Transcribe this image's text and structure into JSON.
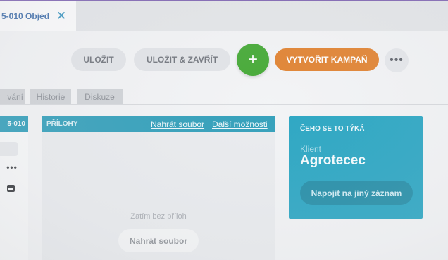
{
  "header": {
    "tab_title": "5-010 Objed",
    "close_glyph": "✕"
  },
  "toolbar": {
    "save_label": "ULOŽIT",
    "save_close_label": "ULOŽIT & ZAVŘÍT",
    "add_glyph": "+",
    "create_campaign_label": "VYTVOŘIT KAMPAŇ",
    "more_glyph": "•••"
  },
  "tabs": [
    {
      "label": "vání"
    },
    {
      "label": "Historie"
    },
    {
      "label": "Diskuze"
    }
  ],
  "left_panel": {
    "header": "5-010",
    "dots_glyph": "•••"
  },
  "attachments": {
    "title": "PŘÍLOHY",
    "upload_link": "Nahrát soubor",
    "more_link": "Další možnosti",
    "empty_text": "Zatím bez příloh",
    "upload_button": "Nahrát soubor"
  },
  "related": {
    "title": "ČEHO SE TO TÝKÁ",
    "label": "Klient",
    "value": "Agrotecec",
    "link_button": "Napojit na jiný záznam"
  },
  "colors": {
    "accent_teal": "#23a3c1",
    "add_green": "#3fa62f",
    "campaign_orange": "#e07f2b",
    "top_line": "#7b5fb0"
  }
}
